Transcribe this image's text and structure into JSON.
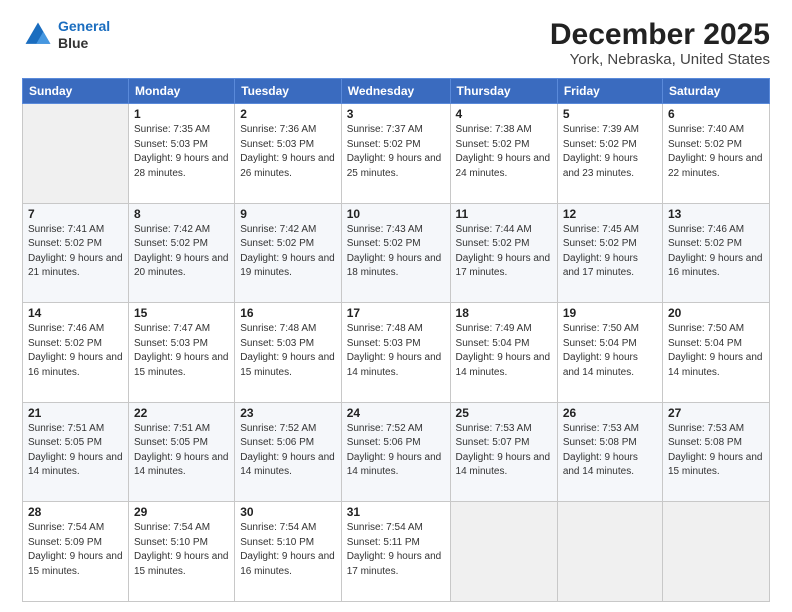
{
  "header": {
    "logo_line1": "General",
    "logo_line2": "Blue",
    "title": "December 2025",
    "subtitle": "York, Nebraska, United States"
  },
  "days_of_week": [
    "Sunday",
    "Monday",
    "Tuesday",
    "Wednesday",
    "Thursday",
    "Friday",
    "Saturday"
  ],
  "weeks": [
    [
      {
        "day": "",
        "sunrise": "",
        "sunset": "",
        "daylight": ""
      },
      {
        "day": "1",
        "sunrise": "7:35 AM",
        "sunset": "5:03 PM",
        "daylight": "9 hours and 28 minutes."
      },
      {
        "day": "2",
        "sunrise": "7:36 AM",
        "sunset": "5:03 PM",
        "daylight": "9 hours and 26 minutes."
      },
      {
        "day": "3",
        "sunrise": "7:37 AM",
        "sunset": "5:02 PM",
        "daylight": "9 hours and 25 minutes."
      },
      {
        "day": "4",
        "sunrise": "7:38 AM",
        "sunset": "5:02 PM",
        "daylight": "9 hours and 24 minutes."
      },
      {
        "day": "5",
        "sunrise": "7:39 AM",
        "sunset": "5:02 PM",
        "daylight": "9 hours and 23 minutes."
      },
      {
        "day": "6",
        "sunrise": "7:40 AM",
        "sunset": "5:02 PM",
        "daylight": "9 hours and 22 minutes."
      }
    ],
    [
      {
        "day": "7",
        "sunrise": "7:41 AM",
        "sunset": "5:02 PM",
        "daylight": "9 hours and 21 minutes."
      },
      {
        "day": "8",
        "sunrise": "7:42 AM",
        "sunset": "5:02 PM",
        "daylight": "9 hours and 20 minutes."
      },
      {
        "day": "9",
        "sunrise": "7:42 AM",
        "sunset": "5:02 PM",
        "daylight": "9 hours and 19 minutes."
      },
      {
        "day": "10",
        "sunrise": "7:43 AM",
        "sunset": "5:02 PM",
        "daylight": "9 hours and 18 minutes."
      },
      {
        "day": "11",
        "sunrise": "7:44 AM",
        "sunset": "5:02 PM",
        "daylight": "9 hours and 17 minutes."
      },
      {
        "day": "12",
        "sunrise": "7:45 AM",
        "sunset": "5:02 PM",
        "daylight": "9 hours and 17 minutes."
      },
      {
        "day": "13",
        "sunrise": "7:46 AM",
        "sunset": "5:02 PM",
        "daylight": "9 hours and 16 minutes."
      }
    ],
    [
      {
        "day": "14",
        "sunrise": "7:46 AM",
        "sunset": "5:02 PM",
        "daylight": "9 hours and 16 minutes."
      },
      {
        "day": "15",
        "sunrise": "7:47 AM",
        "sunset": "5:03 PM",
        "daylight": "9 hours and 15 minutes."
      },
      {
        "day": "16",
        "sunrise": "7:48 AM",
        "sunset": "5:03 PM",
        "daylight": "9 hours and 15 minutes."
      },
      {
        "day": "17",
        "sunrise": "7:48 AM",
        "sunset": "5:03 PM",
        "daylight": "9 hours and 14 minutes."
      },
      {
        "day": "18",
        "sunrise": "7:49 AM",
        "sunset": "5:04 PM",
        "daylight": "9 hours and 14 minutes."
      },
      {
        "day": "19",
        "sunrise": "7:50 AM",
        "sunset": "5:04 PM",
        "daylight": "9 hours and 14 minutes."
      },
      {
        "day": "20",
        "sunrise": "7:50 AM",
        "sunset": "5:04 PM",
        "daylight": "9 hours and 14 minutes."
      }
    ],
    [
      {
        "day": "21",
        "sunrise": "7:51 AM",
        "sunset": "5:05 PM",
        "daylight": "9 hours and 14 minutes."
      },
      {
        "day": "22",
        "sunrise": "7:51 AM",
        "sunset": "5:05 PM",
        "daylight": "9 hours and 14 minutes."
      },
      {
        "day": "23",
        "sunrise": "7:52 AM",
        "sunset": "5:06 PM",
        "daylight": "9 hours and 14 minutes."
      },
      {
        "day": "24",
        "sunrise": "7:52 AM",
        "sunset": "5:06 PM",
        "daylight": "9 hours and 14 minutes."
      },
      {
        "day": "25",
        "sunrise": "7:53 AM",
        "sunset": "5:07 PM",
        "daylight": "9 hours and 14 minutes."
      },
      {
        "day": "26",
        "sunrise": "7:53 AM",
        "sunset": "5:08 PM",
        "daylight": "9 hours and 14 minutes."
      },
      {
        "day": "27",
        "sunrise": "7:53 AM",
        "sunset": "5:08 PM",
        "daylight": "9 hours and 15 minutes."
      }
    ],
    [
      {
        "day": "28",
        "sunrise": "7:54 AM",
        "sunset": "5:09 PM",
        "daylight": "9 hours and 15 minutes."
      },
      {
        "day": "29",
        "sunrise": "7:54 AM",
        "sunset": "5:10 PM",
        "daylight": "9 hours and 15 minutes."
      },
      {
        "day": "30",
        "sunrise": "7:54 AM",
        "sunset": "5:10 PM",
        "daylight": "9 hours and 16 minutes."
      },
      {
        "day": "31",
        "sunrise": "7:54 AM",
        "sunset": "5:11 PM",
        "daylight": "9 hours and 17 minutes."
      },
      {
        "day": "",
        "sunrise": "",
        "sunset": "",
        "daylight": ""
      },
      {
        "day": "",
        "sunrise": "",
        "sunset": "",
        "daylight": ""
      },
      {
        "day": "",
        "sunrise": "",
        "sunset": "",
        "daylight": ""
      }
    ]
  ],
  "labels": {
    "sunrise": "Sunrise:",
    "sunset": "Sunset:",
    "daylight": "Daylight:"
  }
}
